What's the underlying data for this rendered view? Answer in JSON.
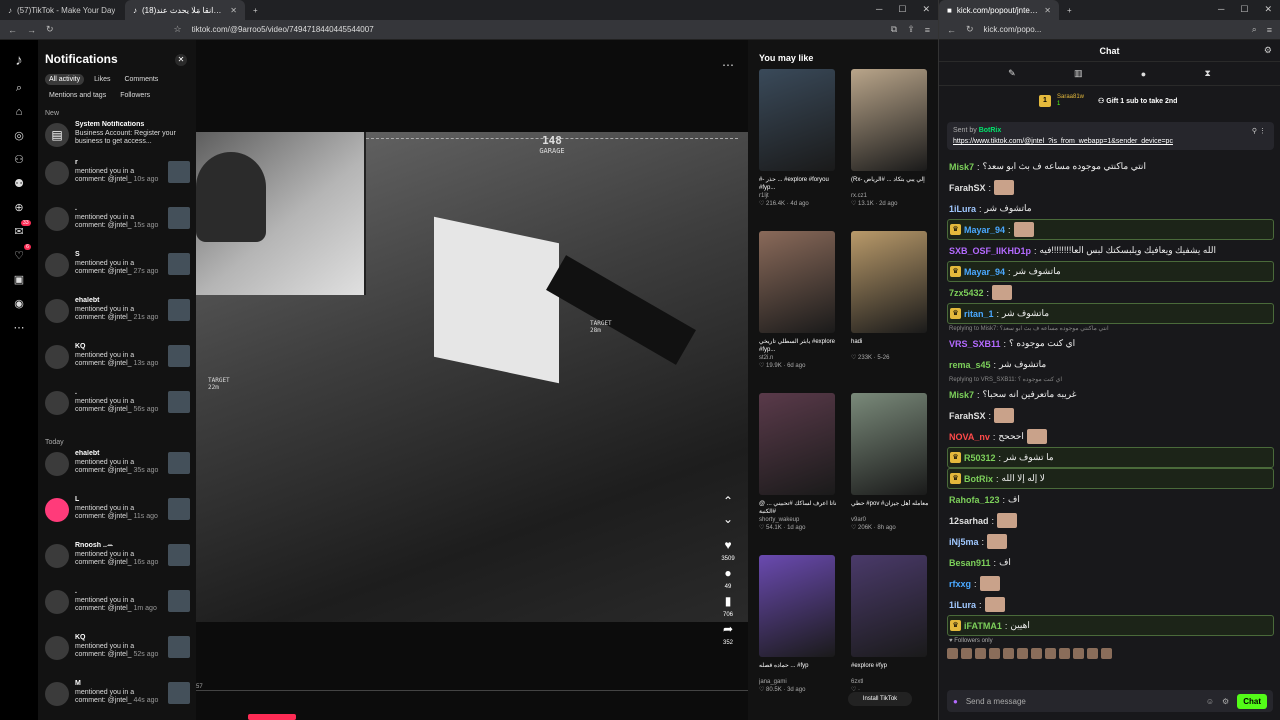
{
  "left_window": {
    "tabs": [
      {
        "label": "(57)TikTok - Make Your Day"
      },
      {
        "label": "(18)منادين قرانقا مَلَا يحدث عند"
      }
    ],
    "url": "tiktok.com/@9arroo5/video/7494718440445544007",
    "rail_badges": [
      "33",
      "6"
    ],
    "notifications": {
      "title": "Notifications",
      "filters": [
        "All activity",
        "Likes",
        "Comments",
        "Mentions and tags",
        "Followers"
      ],
      "section_new": "New",
      "section_today": "Today",
      "system": {
        "title": "System Notifications",
        "text": "Business Account: Register your business to get access..."
      },
      "items_new": [
        {
          "user": "r",
          "text": "mentioned you in a comment: @jntel_",
          "time": "10s ago"
        },
        {
          "user": ".",
          "text": "mentioned you in a comment: @jntel_",
          "time": "15s ago"
        },
        {
          "user": "S",
          "text": "mentioned you in a comment: @jntel_",
          "time": "27s ago"
        },
        {
          "user": "ehalebt",
          "text": "mentioned you in a comment: @jntel_",
          "time": "21s ago"
        },
        {
          "user": "KQ",
          "text": "mentioned you in a comment: @jntel_",
          "time": "13s ago"
        },
        {
          "user": ".",
          "text": "mentioned you in a comment: @jntel_",
          "time": "56s ago"
        }
      ],
      "items_today": [
        {
          "user": "ehalebt",
          "text": "mentioned you in a comment: @jntel_",
          "time": "35s ago"
        },
        {
          "user": "L",
          "text": "mentioned you in a comment: @jntel_",
          "time": "11s ago"
        },
        {
          "user": "Rnoosh ..ꕀ",
          "text": "mentioned you in a comment: @jntel_",
          "time": "16s ago"
        },
        {
          "user": ".",
          "text": "mentioned you in a comment: @jntel_",
          "time": "1m ago"
        },
        {
          "user": "KQ",
          "text": "mentioned you in a comment: @jntel_",
          "time": "52s ago"
        },
        {
          "user": "M",
          "text": "mentioned you in a comment: @jntel_",
          "time": "44s ago"
        }
      ]
    },
    "video": {
      "hud_numbers": "120 | 148 | 105",
      "hud_center": "148",
      "hud_label": "GARAGE",
      "target1": "TARGET",
      "target1_dist": "28m",
      "target2": "TARGET",
      "target2_dist": "22m",
      "time": "57",
      "likes": "3509",
      "comments": "49",
      "saves": "706",
      "shares": "352"
    },
    "you_may_like": {
      "title": "You may like",
      "cards": [
        {
          "caption": "#- حذر ... #explore #foryou #fyp...",
          "author": "r1ljt",
          "likes": "216.4K",
          "age": "4d ago",
          "color": "#3a4a5a"
        },
        {
          "caption": "(Rx- إلي يبي بتكاد ... #الرياض",
          "author": "rx.cz1",
          "likes": "13.1K",
          "age": "2d ago",
          "color": "#b9a58a"
        },
        {
          "caption": "يابثر السطلي تاريخي #explore #fyp...",
          "author": "st2i.n",
          "likes": "19.9K",
          "age": "6d ago",
          "color": "#8a6a5a"
        },
        {
          "caption": "hadi",
          "author": "",
          "likes": "233K",
          "age": "5-26",
          "color": "#b99a6a"
        },
        {
          "caption": "@ ناتا اعرف لساكك #تحبيني ... #الكنبة",
          "author": "shorty_wakeup",
          "likes": "54.1K",
          "age": "1d ago",
          "color": "#5a3a4a"
        },
        {
          "caption": "حطي #pov #معامله أهل جيزان",
          "author": "v9ar0",
          "likes": "206K",
          "age": "8h ago",
          "color": "#7a8a7a"
        },
        {
          "caption": "حماده قصله ... #fyp",
          "author": "jana_gami",
          "likes": "80.5K",
          "age": "3d ago",
          "color": "#6a4ab0"
        },
        {
          "caption": "#explore #fyp",
          "author": "6zxtl",
          "likes": "",
          "age": "",
          "color": "#4a3a6a"
        }
      ],
      "install": "Install TikTok"
    }
  },
  "right_window": {
    "tab": "kick.com/popout/jntel/chat",
    "url": "kick.com/popo...",
    "chat_title": "Chat",
    "sub": {
      "user": "Saraa81w",
      "rank": "1",
      "count": "1",
      "gift": "Gift 1 sub to take 2nd"
    },
    "pinned": {
      "sent_by": "Sent by",
      "user": "BotRix",
      "link": "https://www.tiktok.com/@jntel_?is_from_webapp=1&sender_device=pc"
    },
    "messages": [
      {
        "name": "Misk7",
        "color": "#7ccf5a",
        "text": "انتي ماكنتي موجوده مساعه ف بث ابو سعد؟",
        "hl": false
      },
      {
        "name": "FarahSX",
        "color": "#e0e0e0",
        "text": "",
        "emote": true,
        "hl": false
      },
      {
        "name": "1iLura",
        "color": "#a0c8ff",
        "text": "ماتشوف شر",
        "hl": false
      },
      {
        "name": "Mayar_94",
        "color": "#4aa8ff",
        "text": "",
        "emote": true,
        "hl": true
      },
      {
        "name": "SXB_OSF_IIKHD1p",
        "color": "#b46aff",
        "text": "الله يشفيك ويعافيك ويلبسكتك لبس العا!!!!!!!!فيه",
        "hl": false
      },
      {
        "name": "Mayar_94",
        "color": "#4aa8ff",
        "text": "ماتشوف شر",
        "hl": true
      },
      {
        "name": "7zx5432",
        "color": "#7ccf5a",
        "text": "",
        "emote": true,
        "hl": false
      },
      {
        "name": "ritan_1",
        "color": "#4aa8ff",
        "text": "ماتشوف شر",
        "hl": true
      },
      {
        "reply": "Replying to Misk7: انتي ماكنتي موجوده مساعه ف بث ابو سعد؟"
      },
      {
        "name": "VRS_SXB11",
        "color": "#b46aff",
        "text": "اي كنت موجوده ؟",
        "hl": false
      },
      {
        "name": "rema_s45",
        "color": "#7ccf5a",
        "text": "ماتشوف شر",
        "hl": false
      },
      {
        "reply": "Replying to VRS_SXB11: اي كنت موجوده ؟"
      },
      {
        "name": "Misk7",
        "color": "#7ccf5a",
        "text": "غريبه ماتعرفين انه سحبا؟",
        "hl": false
      },
      {
        "name": "FarahSX",
        "color": "#e0e0e0",
        "text": "",
        "emote": true,
        "hl": false
      },
      {
        "name": "NOVA_nv",
        "color": "#ff4a4a",
        "text": "احححح",
        "emote": true,
        "hl": false
      },
      {
        "name": "R50312",
        "color": "#7ccf5a",
        "text": "ما تشوف شر",
        "hl": true
      },
      {
        "name": "BotRix",
        "color": "#7ccf5a",
        "text": "لا إله إلا الله",
        "hl": true
      },
      {
        "name": "Rahofa_123",
        "color": "#7ccf5a",
        "text": "اف",
        "hl": false
      },
      {
        "name": "12sarhad",
        "color": "#e0e0e0",
        "text": "",
        "emote": true,
        "hl": false
      },
      {
        "name": "iNj5ma",
        "color": "#a0c8ff",
        "text": "",
        "emote": true,
        "hl": false
      },
      {
        "name": "Besan911",
        "color": "#7ccf5a",
        "text": "اف",
        "hl": false
      },
      {
        "name": "rfxxg",
        "color": "#4aa8ff",
        "text": "",
        "emote": true,
        "hl": false
      },
      {
        "name": "1iLura",
        "color": "#a0c8ff",
        "text": "",
        "emote": true,
        "hl": false
      },
      {
        "name": "iFATMA1",
        "color": "#7ccf5a",
        "text": "اهيين",
        "hl": true
      }
    ],
    "followers_only": "Followers only",
    "input_placeholder": "Send a message",
    "chat_button": "Chat"
  }
}
